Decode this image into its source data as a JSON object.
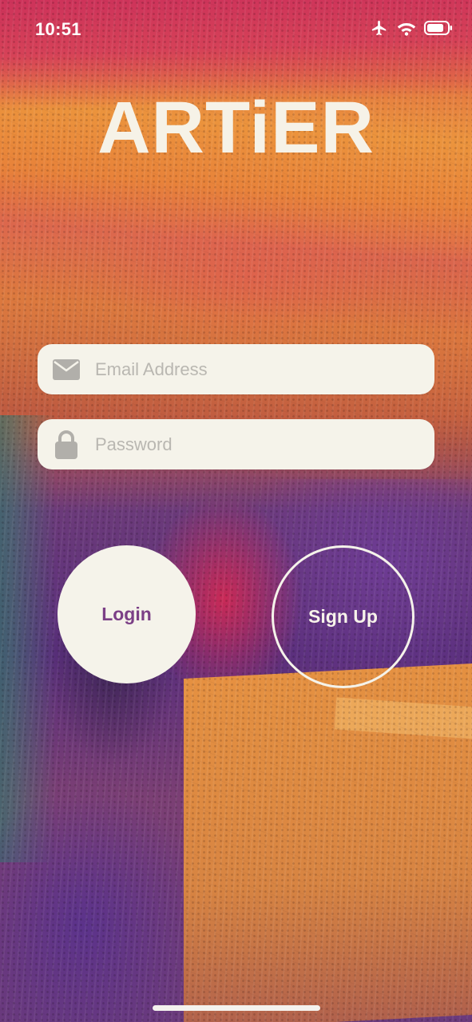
{
  "status_bar": {
    "time": "10:51",
    "icons": [
      "airplane-icon",
      "wifi-icon",
      "battery-icon"
    ]
  },
  "app": {
    "logo": "ARTiER"
  },
  "form": {
    "email": {
      "placeholder": "Email Address",
      "value": "",
      "icon": "envelope-icon"
    },
    "password": {
      "placeholder": "Password",
      "value": "",
      "icon": "lock-icon"
    }
  },
  "buttons": {
    "login_label": "Login",
    "signup_label": "Sign Up"
  },
  "colors": {
    "field_background": "#f5f3ea",
    "login_text": "#7b3f86",
    "logo_text": "#f6f2e7",
    "icon_gray": "#b1afaa"
  }
}
